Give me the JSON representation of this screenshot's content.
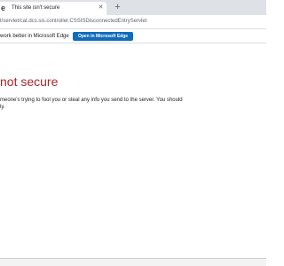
{
  "tab": {
    "favicon": "edge-icon",
    "title": "This site isn't secure",
    "close_glyph": "✕",
    "new_tab_glyph": "+"
  },
  "address_bar": {
    "url": "t/servlet/cat.dcs.sis.controller.CSSISDisconnectedEntryServlet"
  },
  "infobar": {
    "message": "work better in Microsoft Edge.",
    "button_label": "Open in Microsoft Edge",
    "button_color": "#0f6cbd"
  },
  "error": {
    "title": "not secure",
    "title_color": "#a4262c",
    "description_line1": "meone's trying to fool you or steal any info you send to the server. You should",
    "description_line2": "ly."
  }
}
